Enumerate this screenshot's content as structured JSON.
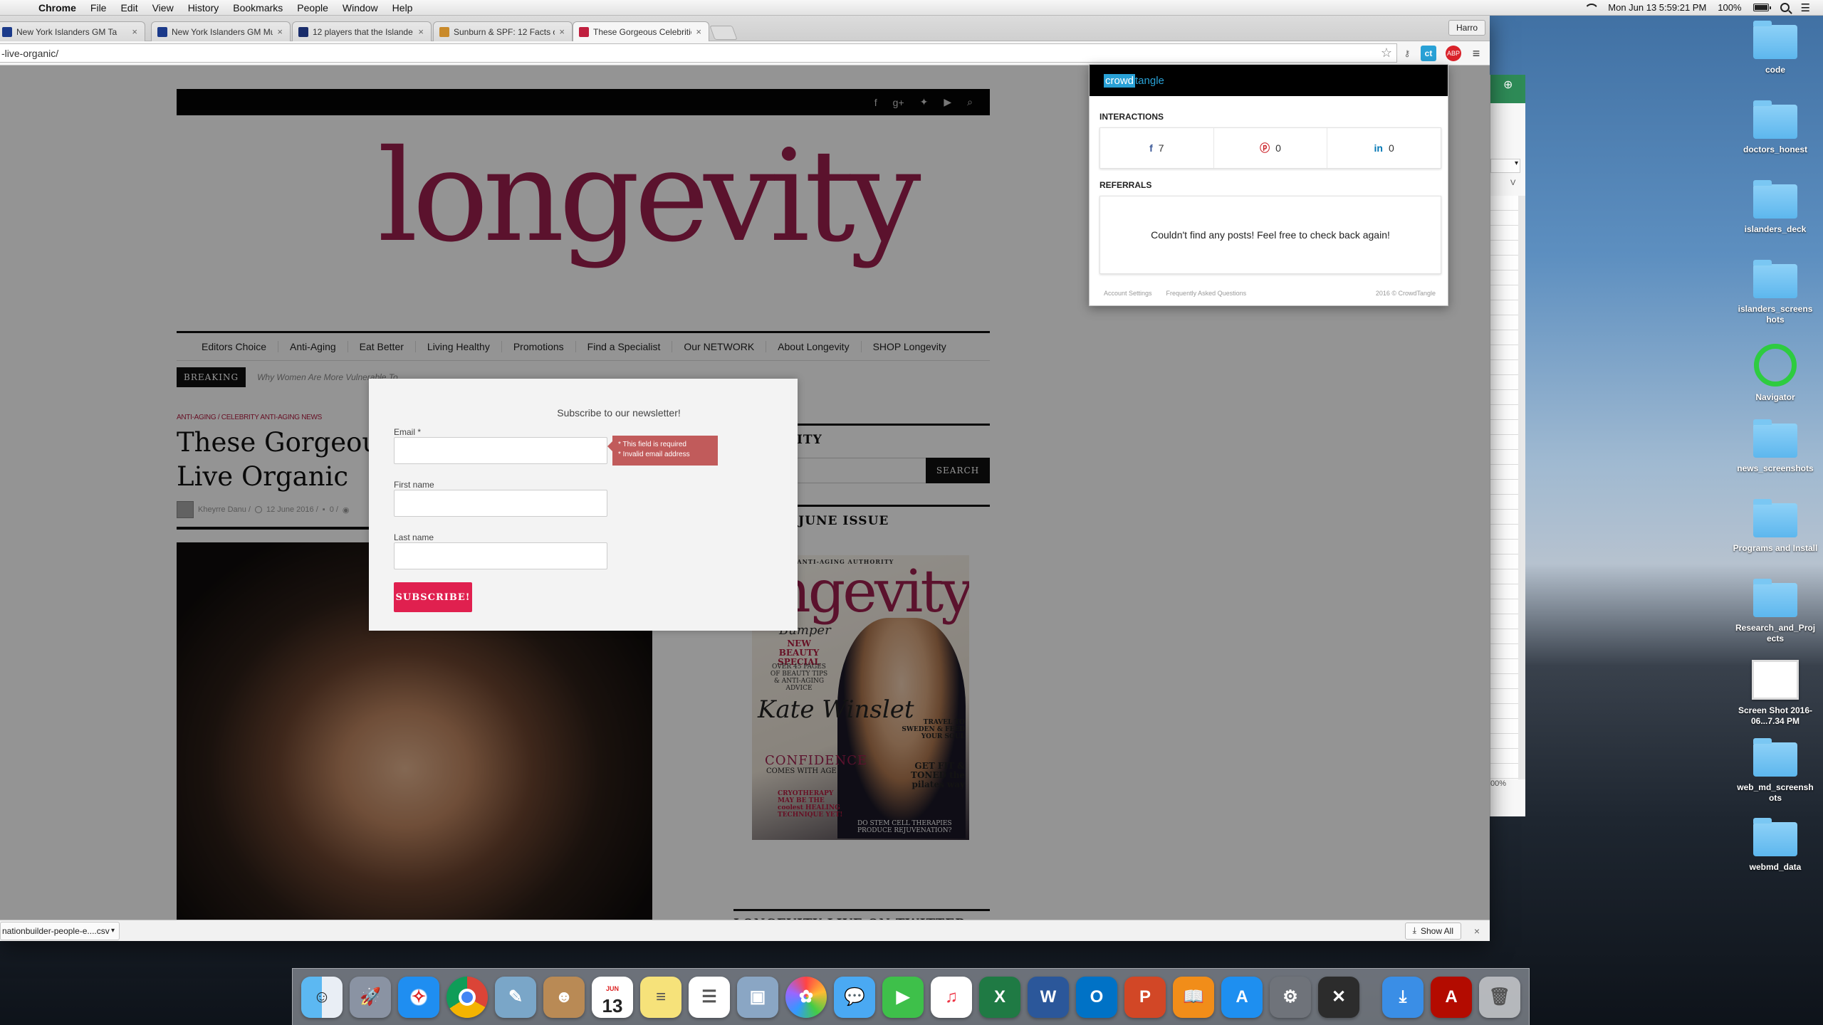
{
  "menubar": {
    "app": "Chrome",
    "items": [
      "File",
      "Edit",
      "View",
      "History",
      "Bookmarks",
      "People",
      "Window",
      "Help"
    ],
    "clock": "Mon Jun 13  5:59:21 PM",
    "battery": "100%"
  },
  "browser": {
    "tabs": [
      {
        "title": "New York Islanders GM Ta",
        "favicon_color": "#1b3a8a"
      },
      {
        "title": "New York Islanders GM Mu",
        "favicon_color": "#1b3a8a"
      },
      {
        "title": "12 players that the Islande",
        "favicon_color": "#1a2d6b"
      },
      {
        "title": "Sunburn & SPF: 12 Facts o",
        "favicon_color": "#c98a2a"
      },
      {
        "title": "These Gorgeous Celebritie",
        "favicon_color": "#c0203f"
      }
    ],
    "profile": "Harro",
    "url": "-live-organic/",
    "download": {
      "file": "nationbuilder-people-e....csv",
      "show_all": "Show All"
    }
  },
  "site": {
    "logo": "longevity",
    "nav": [
      "Editors Choice",
      "Anti-Aging",
      "Eat Better",
      "Living Healthy",
      "Promotions",
      "Find a Specialist",
      "Our NETWORK",
      "About Longevity",
      "SHOP Longevity"
    ],
    "breaking_label": "BREAKING",
    "breaking_text": "Why Women Are More Vulnerable To ...",
    "categories": "ANTI-AGING  /  CELEBRITY ANTI-AGING NEWS",
    "title": "These Gorgeous Celebrities Live Organic",
    "title_line1": "These Gorgeous",
    "title_line2": "Live Organic",
    "author": "Kheyrre Danu  /",
    "date": "12 June 2016  /",
    "comments": "0  /",
    "sidebar_about": "LONGEVITY",
    "search_btn": "SEARCH",
    "issue_head": "HE MAY JUNE ISSUE",
    "twitter_head": "LONGEVITY LIVE ON TWITTER",
    "magazine": {
      "tagline": "UR ANTI-AGING AUTHORITY",
      "logo": "ngevity",
      "bumper": "Bumper",
      "special": "NEW BEAUTY SPECIAL",
      "pages": "OVER 45 PAGES OF BEAUTY TIPS & ANTI-AGING ADVICE",
      "name": "Kate Winslet",
      "confidence": "CONFIDENCE",
      "comes": "COMES WITH AGE",
      "travel": "TRAVEL TO SWEDEN & FEED YOUR SOUL",
      "fit": "GET FIT & TONED the pilates way",
      "cryo": "CRYOTHERAPY MAY BE THE coolest HEALING TECHNIQUE YET!",
      "stem": "DO STEM CELL THERAPIES PRODUCE REJUVENATION?"
    }
  },
  "modal": {
    "title": "Subscribe to our newsletter!",
    "email_label": "Email *",
    "errors": [
      "* This field is required",
      "* Invalid email address"
    ],
    "first_label": "First name",
    "last_label": "Last name",
    "submit": "SUBSCRIBE!"
  },
  "crowdtangle": {
    "brand_a": "crowd",
    "brand_b": "tangle",
    "interactions_title": "INTERACTIONS",
    "facebook": "7",
    "pinterest": "0",
    "linkedin": "0",
    "referrals_title": "REFERRALS",
    "referrals_text": "Couldn't find any posts! Feel free to check back again!",
    "footer_settings": "Account Settings",
    "footer_faq": "Frequently Asked Questions",
    "footer_copy": "2016 © CrowdTangle"
  },
  "sheet": {
    "zoom": "00%",
    "col": "V"
  },
  "desktop": [
    {
      "label": "code",
      "type": "folder"
    },
    {
      "label": "doctors_honest",
      "type": "folder"
    },
    {
      "label": "islanders_deck",
      "type": "folder"
    },
    {
      "label": "islanders_screens hots",
      "type": "folder"
    },
    {
      "label": "Navigator",
      "type": "app"
    },
    {
      "label": "news_screenshots",
      "type": "folder"
    },
    {
      "label": "Programs and Install",
      "type": "folder"
    },
    {
      "label": "Research_and_Proj ects",
      "type": "folder"
    },
    {
      "label": "Screen Shot 2016-06...7.34 PM",
      "type": "file"
    },
    {
      "label": "web_md_screensh ots",
      "type": "folder"
    },
    {
      "label": "webmd_data",
      "type": "folder"
    }
  ],
  "dock": [
    "Finder",
    "Launchpad",
    "Safari",
    "Chrome",
    "Preview",
    "Contacts",
    "Calendar",
    "Notes",
    "Reminders",
    "Photo Booth",
    "Photos",
    "Messages",
    "FaceTime",
    "iTunes",
    "Excel",
    "Word",
    "Outlook",
    "PowerPoint",
    "iBooks",
    "App Store",
    "System Preferences",
    "X11",
    "Downloads",
    "Acrobat",
    "Trash"
  ],
  "dock_date": "13",
  "dock_month": "JUN"
}
